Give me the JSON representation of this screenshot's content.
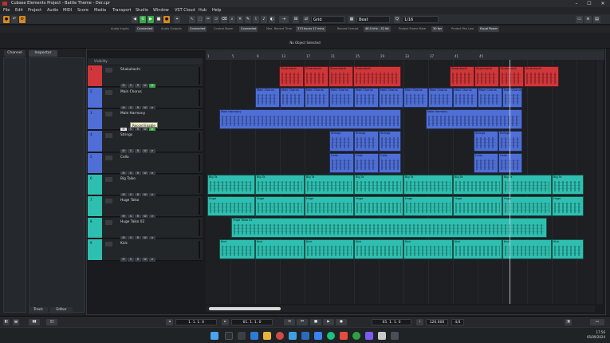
{
  "window": {
    "title": "Cubase Elements Project - Battle Theme - Der.cpr",
    "controls": [
      "–",
      "☐",
      "✕"
    ]
  },
  "menu": [
    "File",
    "Edit",
    "Project",
    "Audio",
    "MIDI",
    "Score",
    "Media",
    "Transport",
    "Studio",
    "Window",
    "VST Cloud",
    "Hub",
    "Help"
  ],
  "toolbar": {
    "grid_type": "Grid",
    "grid_value": "Beat",
    "quantize": "1/16"
  },
  "status": [
    {
      "key": "Audio Inputs",
      "value": "Connected"
    },
    {
      "key": "Audio Outputs",
      "value": "Connected"
    },
    {
      "key": "Control Room",
      "value": "Connected"
    },
    {
      "key": "Max. Record Time",
      "value": "373 hours 17 mins"
    },
    {
      "key": "Record Format",
      "value": "48.0 kHz - 32 bit"
    },
    {
      "key": "Project Frame Rate",
      "value": "30 fps"
    },
    {
      "key": "Project Pan Law",
      "value": "Equal Power"
    }
  ],
  "info_message": "No Object Selected",
  "left_tabs": {
    "channel": "Channel",
    "inspector": "Inspector"
  },
  "bottom_tabs": {
    "track": "Track",
    "editor": "Editor"
  },
  "visibility_label": "Visibility",
  "ruler_marks": [
    "1",
    "5",
    "9",
    "13",
    "17",
    "21",
    "25",
    "29",
    "33",
    "37",
    "41",
    "45"
  ],
  "tracks": [
    {
      "num": "1",
      "name": "Shakuhachi",
      "color": "#d0373a"
    },
    {
      "num": "2",
      "name": "Main Chorus",
      "color": "#4f6fd6"
    },
    {
      "num": "3",
      "name": "Male Harmony",
      "color": "#4f6fd6"
    },
    {
      "num": "4",
      "name": "Strings",
      "color": "#4f6fd6"
    },
    {
      "num": "5",
      "name": "Cello",
      "color": "#4f6fd6"
    },
    {
      "num": "6",
      "name": "Big Taiko",
      "color": "#2fbfb0"
    },
    {
      "num": "7",
      "name": "Huge Taiko",
      "color": "#2fbfb0"
    },
    {
      "num": "8",
      "name": "Huge Taiko 02",
      "color": "#2fbfb0"
    },
    {
      "num": "9",
      "name": "Kick",
      "color": "#2fbfb0"
    }
  ],
  "track_buttons": [
    "M",
    "S",
    "R",
    "W",
    "e"
  ],
  "tooltip": "Record Enable",
  "clip_labels": {
    "red": "Shakuhachi",
    "main": "Main Chorus",
    "harmony": "Male Harmony",
    "strings": "Strings",
    "cello": "Cello",
    "big": "Big Ta",
    "huge": "Huge",
    "huge2": "Huge Taiko 02",
    "kick": "Kick"
  },
  "transport": {
    "left_locator": "1. 1. 1. 0",
    "right_locator": "61. 1. 1. 0",
    "position": "65. 1. 1. 0",
    "tempo": "120.000",
    "signature": "4/4"
  },
  "clock": {
    "time": "17:56",
    "date": "05/09/2024"
  }
}
